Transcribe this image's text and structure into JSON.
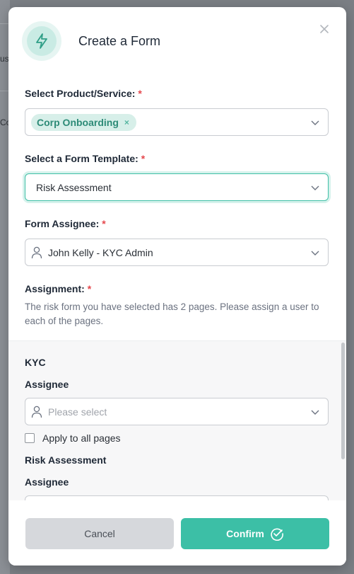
{
  "background": {
    "fragments": [
      "Co",
      "us"
    ]
  },
  "modal": {
    "title": "Create a Form",
    "icon": "lightning-icon",
    "fields": {
      "product": {
        "label": "Select Product/Service:",
        "required_mark": "*",
        "tag": "Corp Onboarding",
        "tag_remove": "×"
      },
      "template": {
        "label": "Select a Form Template:",
        "required_mark": "*",
        "value": "Risk Assessment"
      },
      "assignee": {
        "label": "Form Assignee:",
        "required_mark": "*",
        "value": "John Kelly - KYC Admin"
      },
      "assignment": {
        "label": "Assignment:",
        "required_mark": "*",
        "description": "The risk form you have selected has 2 pages. Please assign a user to each of the pages."
      }
    },
    "pages": [
      {
        "title": "KYC",
        "assignee_label": "Assignee",
        "placeholder": "Please select",
        "apply_all": "Apply to all pages"
      },
      {
        "title": "Risk Assessment",
        "assignee_label": "Assignee"
      }
    ],
    "footer": {
      "cancel": "Cancel",
      "confirm": "Confirm"
    }
  },
  "colors": {
    "accent": "#3cbfa6",
    "required": "#e5484d",
    "tag_bg": "#d7efe9"
  }
}
